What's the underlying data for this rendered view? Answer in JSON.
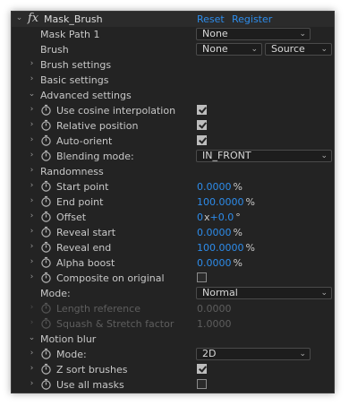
{
  "effect": {
    "fx_label": "fx",
    "name": "Mask_Brush",
    "reset": "Reset",
    "register": "Register"
  },
  "mask_path": {
    "label": "Mask Path 1",
    "value": "None"
  },
  "brush": {
    "label": "Brush",
    "value": "None",
    "source": "Source"
  },
  "groups": {
    "brush_settings": "Brush settings",
    "basic_settings": "Basic settings",
    "advanced_settings": "Advanced settings",
    "randomness": "Randomness",
    "motion_blur": "Motion blur"
  },
  "advanced": {
    "cosine": {
      "label": "Use cosine interpolation",
      "checked": true
    },
    "relative": {
      "label": "Relative position",
      "checked": true
    },
    "orient": {
      "label": "Auto-orient",
      "checked": true
    },
    "blending": {
      "label": "Blending mode:",
      "value": "IN_FRONT"
    }
  },
  "randomness": {
    "start_point": {
      "label": "Start point",
      "value": "0.0000",
      "unit": "%"
    },
    "end_point": {
      "label": "End point",
      "value": "100.0000",
      "unit": "%"
    },
    "offset": {
      "label": "Offset",
      "turns": "0",
      "x_label": "x",
      "degrees": "+0.0",
      "unit": "°"
    },
    "reveal_start": {
      "label": "Reveal start",
      "value": "0.0000",
      "unit": "%"
    },
    "reveal_end": {
      "label": "Reveal end",
      "value": "100.0000",
      "unit": "%"
    },
    "alpha_boost": {
      "label": "Alpha boost",
      "value": "0.0000",
      "unit": "%"
    },
    "composite": {
      "label": "Composite on original",
      "checked": false
    }
  },
  "mode": {
    "label": "Mode:",
    "value": "Normal"
  },
  "length_reference": {
    "label": "Length reference",
    "value": "0.0000"
  },
  "squash": {
    "label": "Squash & Stretch factor",
    "value": "1.0000"
  },
  "motion_blur": {
    "mode": {
      "label": "Mode:",
      "value": "2D"
    },
    "z_sort": {
      "label": "Z sort brushes",
      "checked": true
    },
    "all_masks": {
      "label": "Use all masks",
      "checked": false
    }
  }
}
